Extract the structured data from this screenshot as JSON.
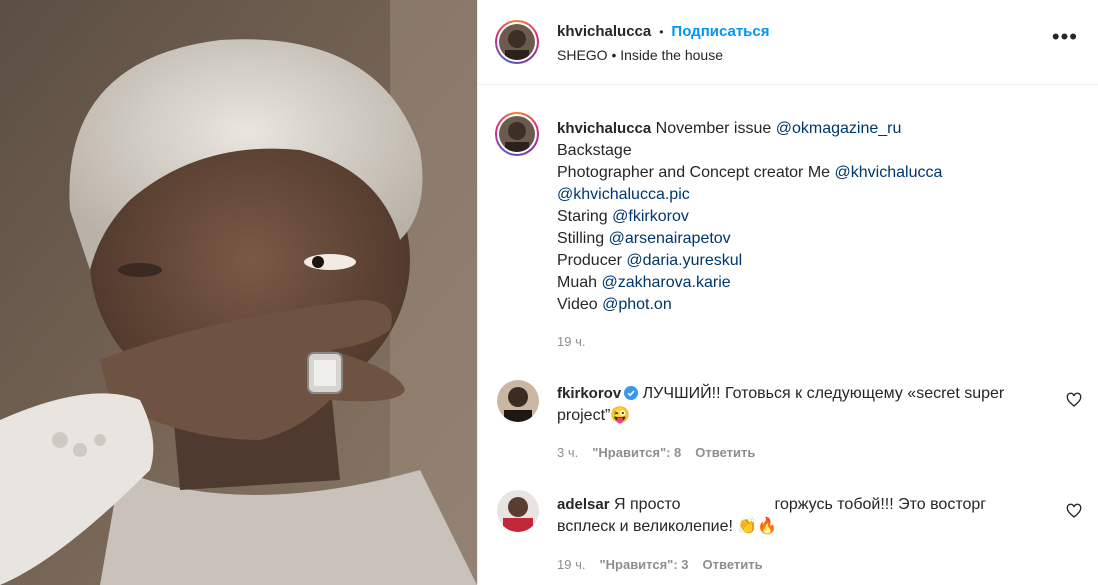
{
  "post": {
    "author": "khvichalucca",
    "follow_label": "Подписаться",
    "separator": "•",
    "location": "SHEGO • Inside the house",
    "more_label": "•••"
  },
  "caption": {
    "author": "khvichalucca",
    "line1_text": "November issue",
    "line1_link": "@okmagazine_ru",
    "line2": "Backstage",
    "line3_text": "Photographer and Concept creator Me",
    "line3_link": "@khvichalucca",
    "line4_link": "@khvichalucca.pic",
    "line5_text": "Staring",
    "line5_link": "@fkirkorov",
    "line6_text": "Stilling",
    "line6_link": "@arsenairapetov",
    "line7_text": "Producer",
    "line7_link": "@daria.yureskul",
    "line8_text": "Muah",
    "line8_link": "@zakharova.karie",
    "line9_text": "Video",
    "line9_link": "@phot.on",
    "time": "19 ч."
  },
  "comments": [
    {
      "author": "fkirkorov",
      "text": "ЛУЧШИЙ!! Готовься к следующему «secret super project”",
      "emoji": "😜",
      "time": "3 ч.",
      "likes": "\"Нравится\": 8",
      "reply": "Ответить"
    },
    {
      "author": "adelsar",
      "text_a": "Я просто",
      "text_b": "горжусь тобой!!! Это восторг всплеск и великолепие!",
      "emoji": "👏🔥",
      "time": "19 ч.",
      "likes": "\"Нравится\": 3",
      "reply": "Ответить"
    }
  ],
  "colors": {
    "link": "#00376b",
    "follow": "#0095f6",
    "muted": "#8e8e8e",
    "verified": "#3897f0"
  },
  "icons": [
    "more-options-icon",
    "heart-icon",
    "verified-badge-icon"
  ]
}
